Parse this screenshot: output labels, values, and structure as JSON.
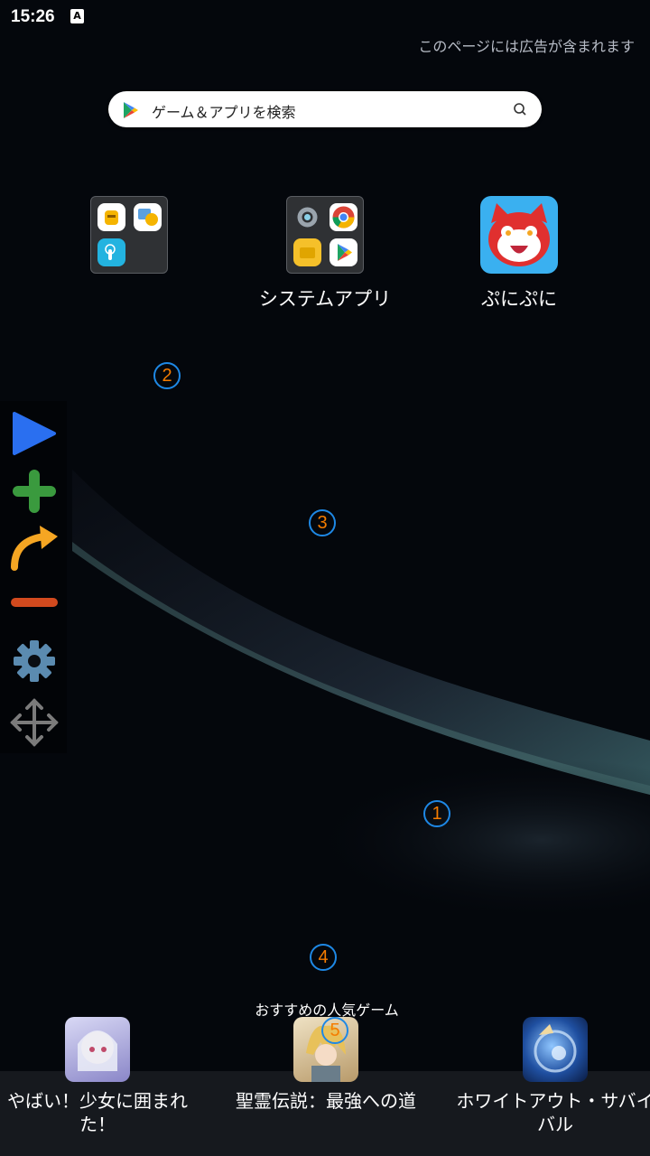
{
  "status": {
    "time": "15:26",
    "notification_glyph": "A"
  },
  "ad_notice": "このページには広告が含まれます",
  "search": {
    "placeholder": "ゲーム＆アプリを検索"
  },
  "apps": [
    {
      "label": "",
      "type": "folder"
    },
    {
      "label": "システムアプリ",
      "type": "folder"
    },
    {
      "label": "ぷにぷに",
      "type": "app"
    }
  ],
  "sidebar": {
    "items": [
      "play-icon",
      "plus-icon",
      "redo-arrow-icon",
      "minus-icon",
      "gear-icon",
      "move-icon"
    ]
  },
  "markers": [
    "1",
    "2",
    "3",
    "4",
    "5"
  ],
  "recommended": {
    "title": "おすすめの人気ゲーム",
    "games": [
      {
        "label": "やばい！少女に囲まれた！"
      },
      {
        "label": "聖霊伝説：最強への道"
      },
      {
        "label": "ホワイトアウト・サバイバル"
      }
    ]
  },
  "colors": {
    "play": "#2a6ff0",
    "plus": "#3a9a3e",
    "redo": "#f5a623",
    "minus": "#d24a1e",
    "gear": "#5b8bb0",
    "move": "#7b7b7b",
    "marker_ring": "#1e88e5",
    "marker_text": "#f57c00"
  }
}
